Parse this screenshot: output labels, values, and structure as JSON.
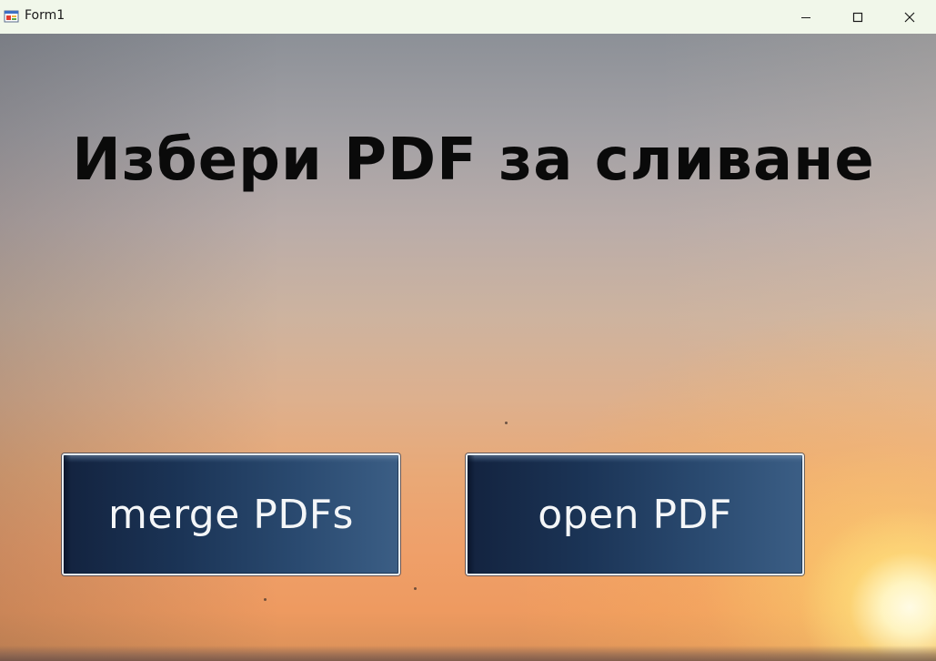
{
  "window": {
    "title": "Form1",
    "icon": "winforms-app-icon",
    "controls": {
      "minimize_icon": "minimize-icon",
      "maximize_icon": "maximize-icon",
      "close_icon": "close-icon"
    }
  },
  "main": {
    "heading": "Избери PDF за сливане",
    "merge_button_label": "merge PDFs",
    "open_button_label": "open PDF"
  },
  "colors": {
    "titlebar_bg": "#f1f7ea",
    "button_dark": "#13233f",
    "button_light": "#3b5e85",
    "button_text": "#f4f6f8",
    "heading_text": "#0a0a0a"
  }
}
